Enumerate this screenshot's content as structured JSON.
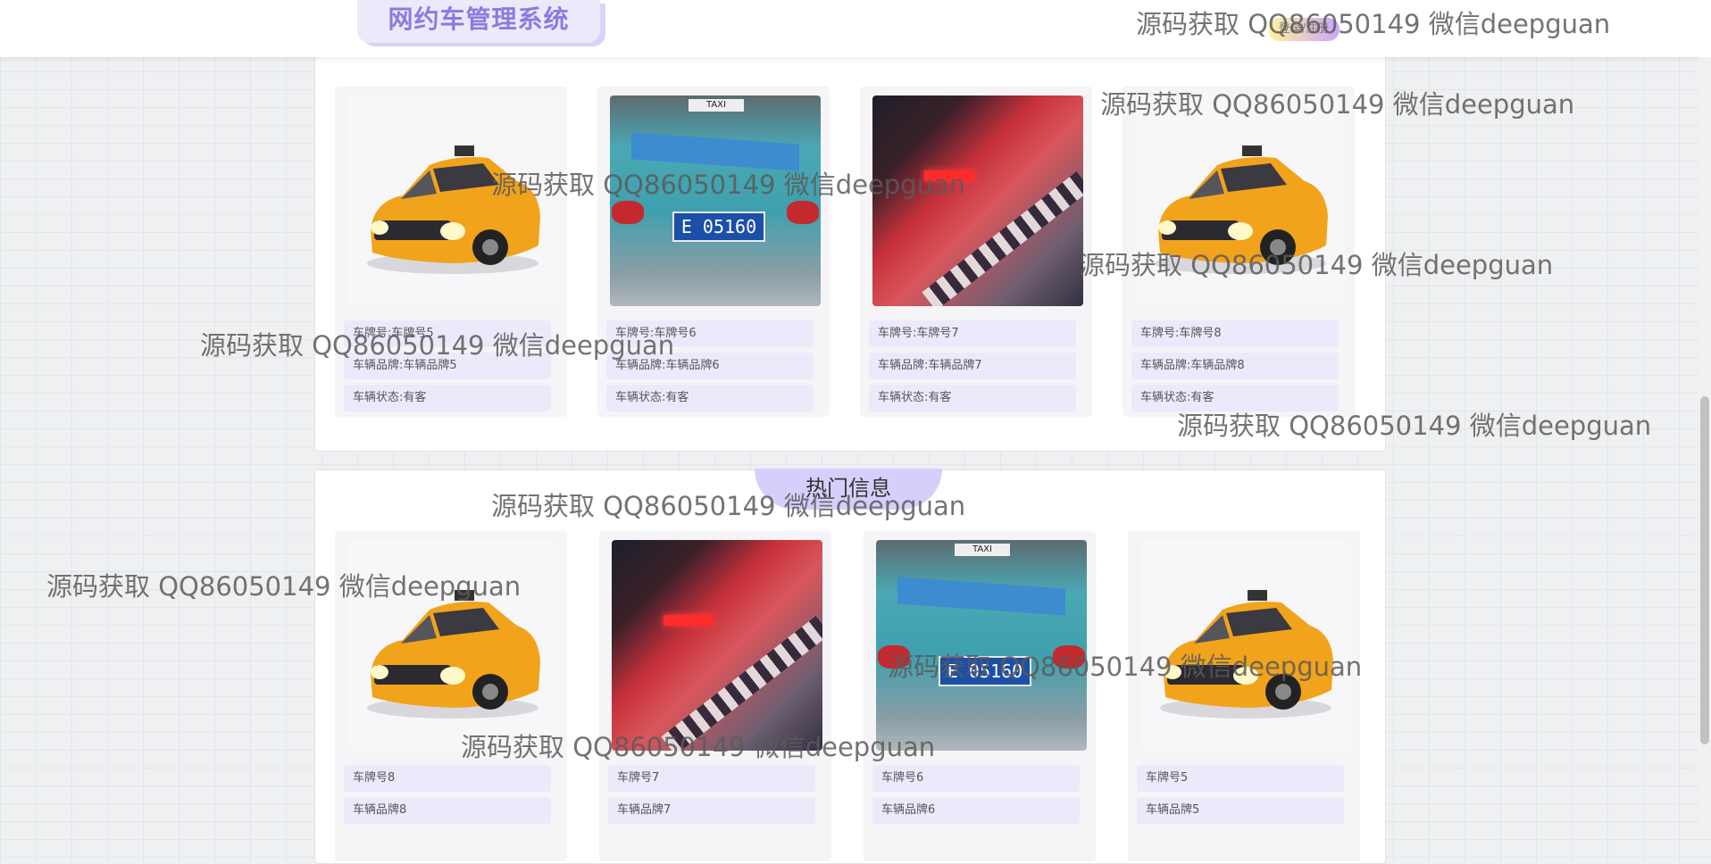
{
  "header": {
    "logo_text": "网约车管理系统",
    "login_label": "登录/注册"
  },
  "hot_section": {
    "title": "热门信息"
  },
  "top_cards": [
    {
      "plate": "车牌号:车牌号5",
      "brand": "车辆品牌:车辆品牌5",
      "status": "车辆状态:有客",
      "image": "yellow-taxi"
    },
    {
      "plate": "车牌号:车牌号6",
      "brand": "车辆品牌:车辆品牌6",
      "status": "车辆状态:有客",
      "image": "teal-taxi-rear"
    },
    {
      "plate": "车牌号:车牌号7",
      "brand": "车辆品牌:车辆品牌7",
      "status": "车辆状态:有客",
      "image": "red-taxi"
    },
    {
      "plate": "车牌号:车牌号8",
      "brand": "车辆品牌:车辆品牌8",
      "status": "车辆状态:有客",
      "image": "yellow-taxi"
    }
  ],
  "hot_cards": [
    {
      "plate": "车牌号8",
      "brand": "车辆品牌8",
      "image": "yellow-taxi"
    },
    {
      "plate": "车牌号7",
      "brand": "车辆品牌7",
      "image": "red-taxi"
    },
    {
      "plate": "车牌号6",
      "brand": "车辆品牌6",
      "image": "teal-taxi-rear"
    },
    {
      "plate": "车牌号5",
      "brand": "车辆品牌5",
      "image": "yellow-taxi"
    }
  ],
  "taxi_photo": {
    "sign": "TAXI",
    "plate_text": "E 05160"
  },
  "watermark_text": "源码获取 QQ86050149 微信deepguan",
  "colors": {
    "accent": "#8c7be0",
    "field_bg": "#ede9fb",
    "title_bg": "#d7cffb"
  }
}
